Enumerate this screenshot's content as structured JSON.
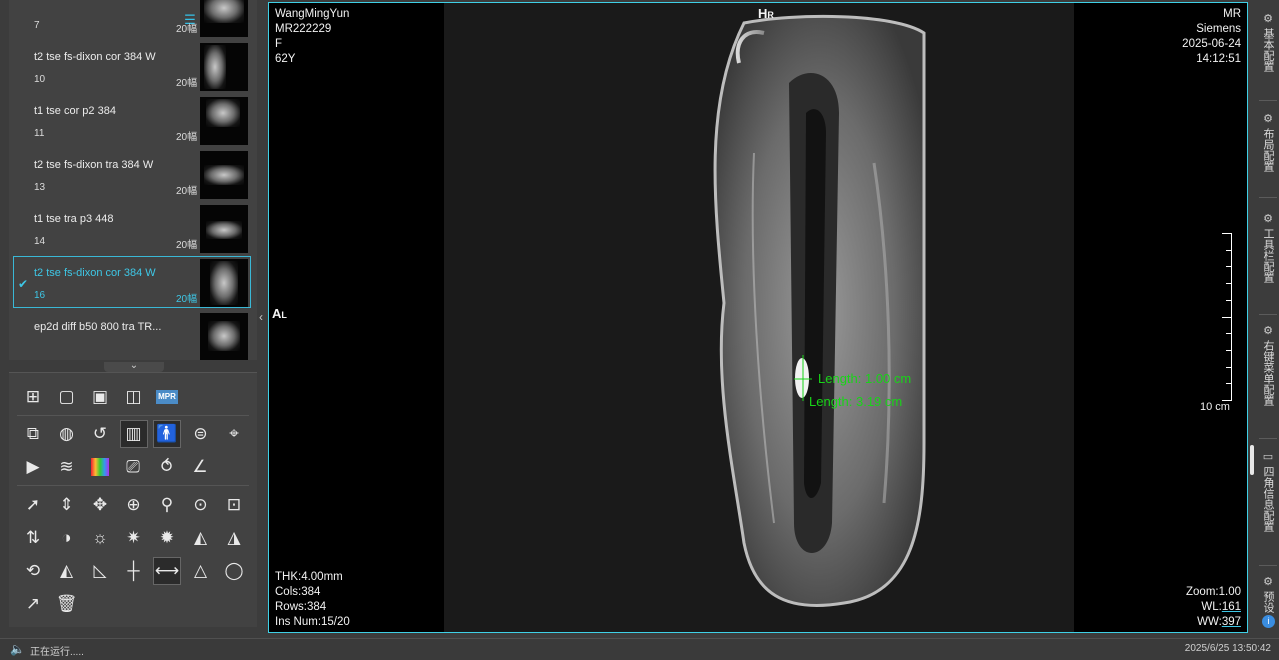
{
  "series_panel": {
    "series": [
      {
        "name": "",
        "number": "7",
        "count": "20幅",
        "selected": false
      },
      {
        "name": "t2 tse fs-dixon cor 384 W",
        "number": "10",
        "count": "20幅",
        "selected": false
      },
      {
        "name": "t1 tse cor p2 384",
        "number": "11",
        "count": "20幅",
        "selected": false
      },
      {
        "name": "t2 tse fs-dixon tra 384 W",
        "number": "13",
        "count": "20幅",
        "selected": false
      },
      {
        "name": "t1 tse tra p3 448",
        "number": "14",
        "count": "20幅",
        "selected": false
      },
      {
        "name": "t2 tse fs-dixon cor 384 W",
        "number": "16",
        "count": "20幅",
        "selected": true
      },
      {
        "name": "ep2d diff b50 800 tra TR...",
        "number": "",
        "count": "",
        "selected": false
      }
    ],
    "view_icons": [
      "list-view-icon",
      "grid-view-icon"
    ]
  },
  "tool_palette": {
    "mpr_label": "MPR"
  },
  "viewer": {
    "top_left": {
      "name": "WangMingYun",
      "id": "MR222229",
      "sex": "F",
      "age": "62Y"
    },
    "top_right": {
      "modality": "MR",
      "manufacturer": "Siemens",
      "date": "2025-06-24",
      "time": "14:12:51"
    },
    "bottom_left": {
      "thickness": "THK:4.00mm",
      "cols": "Cols:384",
      "rows": "Rows:384",
      "ins_num": "Ins Num:15/20"
    },
    "bottom_right": {
      "zoom": "Zoom:1.00",
      "wl_label": "WL:",
      "wl_value": "161",
      "ww_label": "WW:",
      "ww_value": "397"
    },
    "orientation": {
      "top_main": "H",
      "top_sub": "R",
      "left_main": "A",
      "left_sub": "L"
    },
    "measurements": [
      "Length: 1.00 cm",
      "Length: 3.19 cm"
    ],
    "scale_label": "10 cm",
    "measure_color": "#18d418",
    "accent_color": "#3ec7e6"
  },
  "config_sidebar": {
    "items": [
      {
        "label": "基本配置",
        "icon": "config-icon"
      },
      {
        "label": "布局配置",
        "icon": "layout-gear-icon"
      },
      {
        "label": "工具栏配置",
        "icon": "toolbar-gear-icon"
      },
      {
        "label": "右键菜单配置",
        "icon": "menu-gear-icon"
      },
      {
        "label": "四角信息配置",
        "icon": "corner-info-icon"
      },
      {
        "label": "预设",
        "icon": "preset-icon"
      }
    ]
  },
  "status_bar": {
    "message": "正在运行.....",
    "datetime": "2025/6/25  13:50:42"
  }
}
